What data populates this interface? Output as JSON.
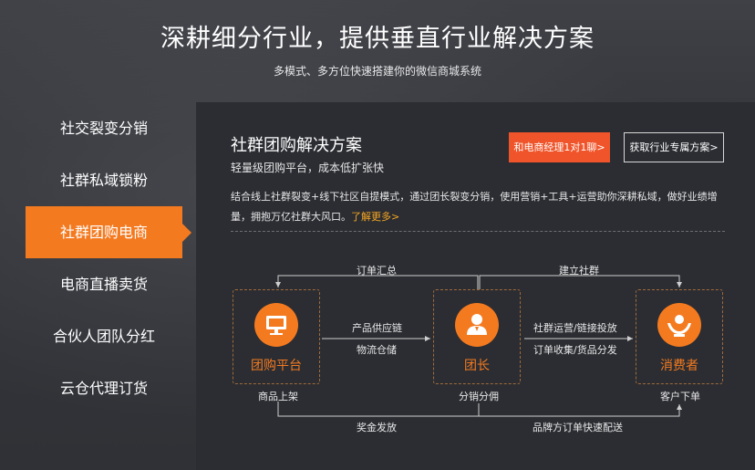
{
  "header": {
    "title": "深耕细分行业，提供垂直行业解决方案",
    "subtitle": "多模式、多方位快速搭建你的微信商城系统"
  },
  "nav": {
    "items": [
      {
        "label": "社交裂变分销",
        "active": false
      },
      {
        "label": "社群私域锁粉",
        "active": false
      },
      {
        "label": "社群团购电商",
        "active": true
      },
      {
        "label": "电商直播卖货",
        "active": false
      },
      {
        "label": "合伙人团队分红",
        "active": false
      },
      {
        "label": "云仓代理订货",
        "active": false
      }
    ]
  },
  "panel": {
    "title": "社群团购解决方案",
    "subtitle": "轻量级团购平台，成本低扩张快",
    "consult_button": "和电商经理1对1聊>",
    "get_plan_button": "获取行业专属方案>",
    "description": "结合线上社群裂变+线下社区自提模式，通过团长裂变分销，使用营销+工具+运营助你深耕私域，做好业绩增量，拥抱万亿社群大风口。",
    "more_link": "了解更多>"
  },
  "flow": {
    "nodes": [
      {
        "label": "团购平台",
        "icon": "monitor-icon",
        "caption": "商品上架"
      },
      {
        "label": "团长",
        "icon": "person-icon",
        "caption": "分销分佣"
      },
      {
        "label": "消费者",
        "icon": "hands-icon",
        "caption": "客户下单"
      }
    ],
    "top_labels": {
      "order_summary": "订单汇总",
      "build_group": "建立社群"
    },
    "mid_labels": {
      "supply_chain": "产品供应链",
      "logistics": "物流仓储",
      "group_ops": "社群运营/链接投放",
      "order_collect": "订单收集/货品分发"
    },
    "bottom_labels": {
      "bonus": "奖金发放",
      "delivery": "品牌方订单快速配送"
    }
  },
  "colors": {
    "accent": "#f47a20",
    "consult_button": "#f0542a",
    "more_link": "#f5a623",
    "panel_bg": "#2b2d32"
  }
}
